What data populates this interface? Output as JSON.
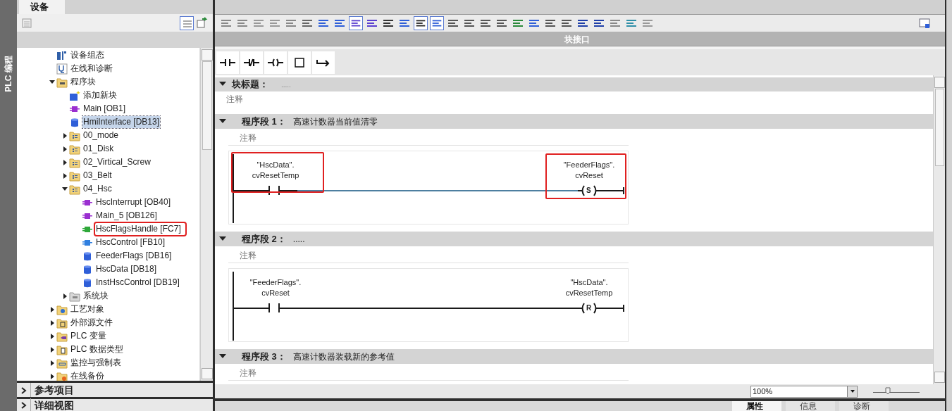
{
  "side_tab": {
    "label": "PLC 编程"
  },
  "project_tree": {
    "tab": {
      "label": "设备",
      "selected": true
    },
    "items": [
      {
        "label": "设备组态",
        "kind": "device",
        "selected": false,
        "annotated": false
      },
      {
        "label": "在线和诊断",
        "kind": "diag",
        "selected": false,
        "annotated": false
      },
      {
        "label": "程序块",
        "kind": "blocks",
        "expanded": true,
        "selected": false,
        "annotated": false,
        "children": [
          {
            "label": "添加新块",
            "kind": "add",
            "selected": false,
            "annotated": false
          },
          {
            "label": "Main [OB1]",
            "kind": "ob",
            "selected": false,
            "annotated": false
          },
          {
            "label": "HmiInterface [DB13]",
            "kind": "db",
            "selected": true,
            "annotated": false
          },
          {
            "label": "00_mode",
            "kind": "group",
            "expanded": false,
            "selected": false,
            "annotated": false
          },
          {
            "label": "01_Disk",
            "kind": "group",
            "expanded": false,
            "selected": false,
            "annotated": false
          },
          {
            "label": "02_Virtical_Screw",
            "kind": "group",
            "expanded": false,
            "selected": false,
            "annotated": false
          },
          {
            "label": "03_Belt",
            "kind": "group",
            "expanded": false,
            "selected": false,
            "annotated": false
          },
          {
            "label": "04_Hsc",
            "kind": "group",
            "expanded": true,
            "selected": false,
            "annotated": false,
            "children": [
              {
                "label": "HscInterrupt [OB40]",
                "kind": "ob",
                "selected": false,
                "annotated": false
              },
              {
                "label": "Main_5 [OB126]",
                "kind": "ob",
                "selected": false,
                "annotated": false
              },
              {
                "label": "HscFlagsHandle [FC7]",
                "kind": "fc",
                "selected": false,
                "annotated": true
              },
              {
                "label": "HscControl [FB10]",
                "kind": "fb",
                "selected": false,
                "annotated": false
              },
              {
                "label": "FeederFlags [DB16]",
                "kind": "db",
                "selected": false,
                "annotated": false
              },
              {
                "label": "HscData [DB18]",
                "kind": "db",
                "selected": false,
                "annotated": false
              },
              {
                "label": "InstHscControl [DB19]",
                "kind": "db",
                "selected": false,
                "annotated": false
              }
            ]
          },
          {
            "label": "系统块",
            "kind": "sys",
            "expanded": false,
            "selected": false,
            "annotated": false
          }
        ]
      },
      {
        "label": "工艺对象",
        "kind": "tech",
        "expanded": false,
        "selected": false,
        "annotated": false
      },
      {
        "label": "外部源文件",
        "kind": "ext",
        "expanded": false,
        "selected": false,
        "annotated": false
      },
      {
        "label": "PLC 变量",
        "kind": "tags",
        "expanded": false,
        "selected": false,
        "annotated": false
      },
      {
        "label": "PLC 数据类型",
        "kind": "types",
        "expanded": false,
        "selected": false,
        "annotated": false
      },
      {
        "label": "监控与强制表",
        "kind": "watch",
        "expanded": false,
        "selected": false,
        "annotated": false
      },
      {
        "label": "在线备份",
        "kind": "backup",
        "expanded": false,
        "selected": false,
        "annotated": false
      }
    ]
  },
  "bottom_panels": [
    {
      "label": "参考项目",
      "expanded": false
    },
    {
      "label": "详细视图",
      "expanded": false
    }
  ],
  "editor": {
    "interface_label": "块接口",
    "block_title": {
      "label": "块标题：",
      "value": "....."
    },
    "block_comment": "注释",
    "networks": [
      {
        "label": "程序段 1：",
        "title": "高速计数器当前值清零",
        "comment": "注释",
        "contact": {
          "operand": "\"HscData\".",
          "member": "cvResetTemp",
          "annotated": true
        },
        "coil": {
          "kind": "set",
          "letter": "S",
          "operand": "\"FeederFlags\".",
          "member": "cvReset",
          "annotated": true
        }
      },
      {
        "label": "程序段 2：",
        "title": ".....",
        "comment": "注释",
        "contact": {
          "operand": "\"FeederFlags\".",
          "member": "cvReset",
          "annotated": false
        },
        "coil": {
          "kind": "reset",
          "letter": "R",
          "operand": "\"HscData\".",
          "member": "cvResetTemp",
          "annotated": false
        }
      },
      {
        "label": "程序段 3：",
        "title": "高速计数器装载新的参考值",
        "comment": "注释"
      }
    ],
    "zoom": "100%",
    "zoom_slider": {
      "level": 0.3
    },
    "bottom_tabs": [
      {
        "label": "属性",
        "selected": true
      },
      {
        "label": "信息",
        "selected": false
      },
      {
        "label": "诊断",
        "selected": false
      }
    ]
  }
}
